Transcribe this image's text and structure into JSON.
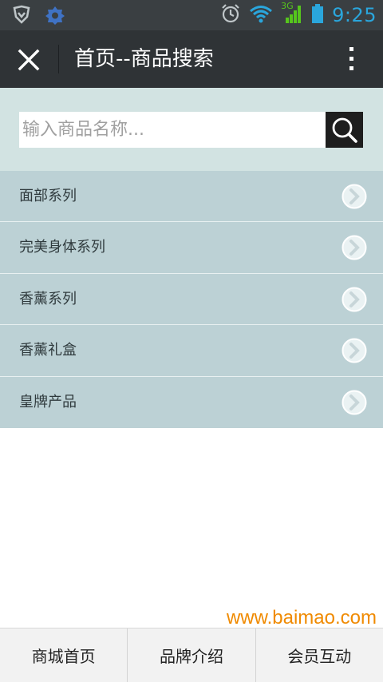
{
  "status_bar": {
    "time": "9:25",
    "network_label": "3G",
    "icons": [
      "shield-icon",
      "settings-icon",
      "alarm-icon",
      "wifi-icon",
      "signal-icon",
      "battery-icon"
    ]
  },
  "header": {
    "title": "首页--商品搜索",
    "close_icon": "close-icon",
    "more_icon": "more-vertical-icon"
  },
  "search": {
    "placeholder": "输入商品名称...",
    "value": "",
    "button_icon": "search-icon"
  },
  "categories": [
    {
      "label": "面部系列"
    },
    {
      "label": "完美身体系列"
    },
    {
      "label": "香薰系列"
    },
    {
      "label": "香薰礼盒"
    },
    {
      "label": "皇牌产品"
    }
  ],
  "watermark": "www.baimao.com",
  "bottom_nav": [
    {
      "label": "商城首页"
    },
    {
      "label": "品牌介绍"
    },
    {
      "label": "会员互动"
    }
  ],
  "colors": {
    "status_bar_bg": "#3a3f42",
    "title_bar_bg": "#2f3336",
    "search_area_bg": "#d2e3e2",
    "category_bg": "#bcd1d5",
    "accent_blue": "#2aa6dc",
    "watermark_orange": "#f08a00"
  }
}
